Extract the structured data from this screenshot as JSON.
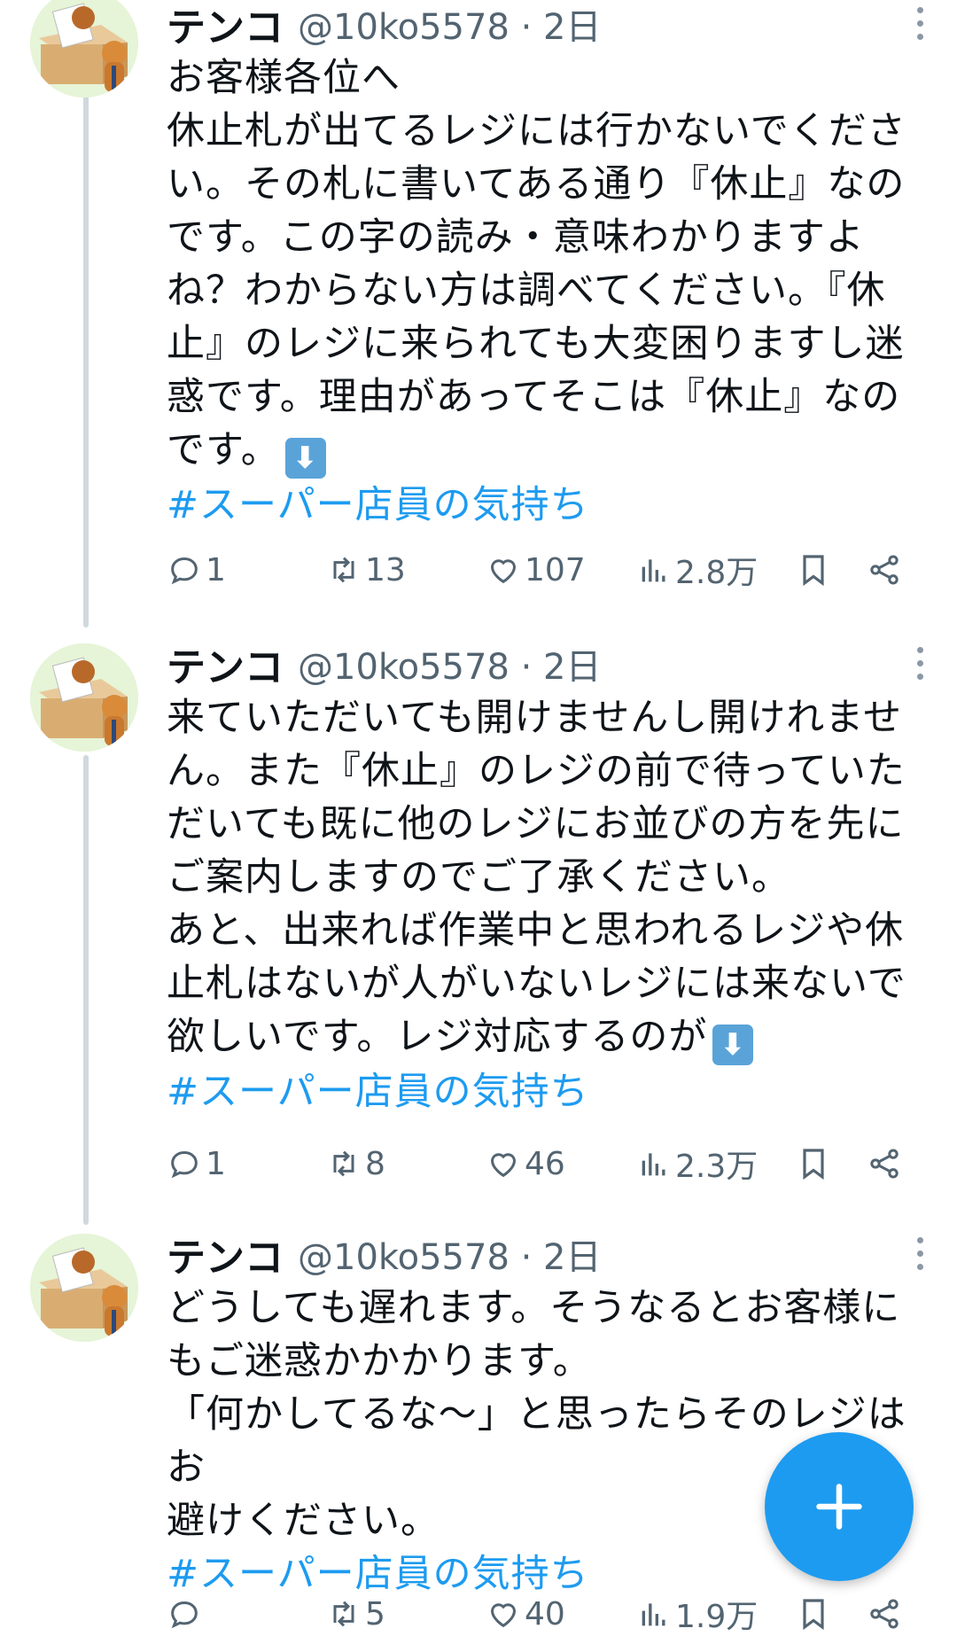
{
  "tweets": [
    {
      "name": "テンコ",
      "handle": "@10ko5578 · 2日",
      "text": "お客様各位へ\n休止札が出てるレジには行かないでくださ\nい。その札に書いてある通り『休止』なの\nです。この字の読み・意味わかりますよ\nね？わからない方は調べてください。『休\n止』のレジに来られても大変困りますし迷\n惑です。理由があってそこは『休止』なの\nです。",
      "emoji": "⬇",
      "hashtag": "#スーパー店員の気持ち",
      "replies": "1",
      "retweets": "13",
      "likes": "107",
      "views": "2.8万"
    },
    {
      "name": "テンコ",
      "handle": "@10ko5578 · 2日",
      "text": "来ていただいても開けませんし開けれませ\nん。また『休止』のレジの前で待っていた\nだいても既に他のレジにお並びの方を先に\nご案内しますのでご了承ください。\nあと、出来れば作業中と思われるレジや休\n止札はないが人がいないレジには来ないで\n欲しいです。レジ対応するのが",
      "emoji": "⬇",
      "hashtag": "#スーパー店員の気持ち",
      "replies": "1",
      "retweets": "8",
      "likes": "46",
      "views": "2.3万"
    },
    {
      "name": "テンコ",
      "handle": "@10ko5578 · 2日",
      "text": "どうしても遅れます。そうなるとお客様に\nもご迷惑かかかります。\n「何かしてるな～」と思ったらそのレジはお\n避けください。",
      "emoji": "",
      "hashtag": "#スーパー店員の気持ち",
      "replies": "",
      "retweets": "5",
      "likes": "40",
      "views": "1.9万"
    }
  ],
  "icons": [
    "reply-icon",
    "retweet-icon",
    "like-icon",
    "views-icon",
    "bookmark-icon",
    "share-icon",
    "more-icon",
    "compose-plus-icon"
  ],
  "colors": {
    "accent": "#1d9bf0",
    "muted": "#536471",
    "text": "#0f1419"
  }
}
